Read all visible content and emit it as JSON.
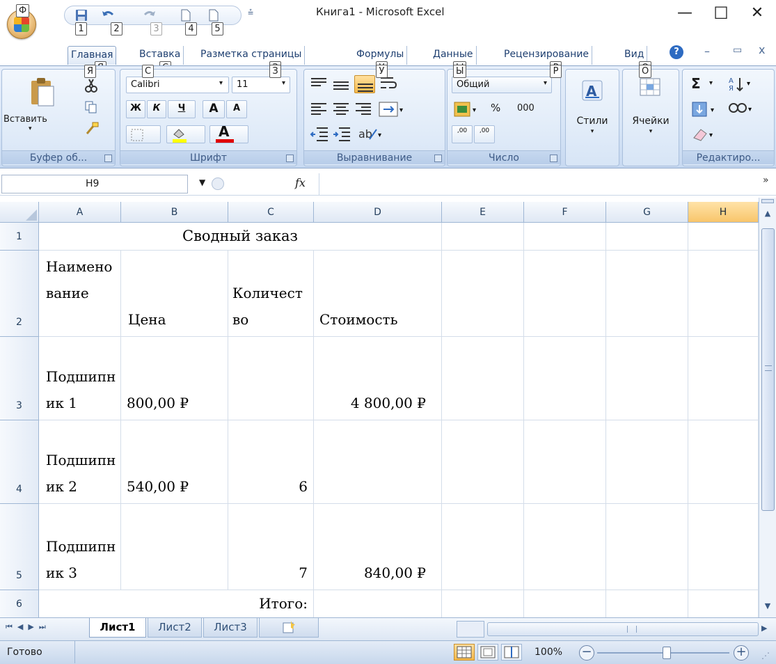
{
  "window": {
    "title": "Книга1 - Microsoft Excel",
    "min": "—",
    "max": "☐",
    "close": "✕",
    "help": "?",
    "min2": "–",
    "restore2": "▭",
    "close2": "x"
  },
  "qat": {
    "keytips": [
      "1",
      "2",
      "3",
      "4",
      "5"
    ],
    "menu_glyph": "⩮",
    "office_keytip": "Ф"
  },
  "tabs": [
    {
      "label": "Главная",
      "keytip": "Я",
      "active": true
    },
    {
      "label": "Вставка",
      "keytip": "С"
    },
    {
      "label": "Разметка страницы",
      "keytip": "З"
    },
    {
      "label": "Формулы",
      "keytip": "У"
    },
    {
      "label": "Данные",
      "keytip": "Ы"
    },
    {
      "label": "Рецензирование",
      "keytip": "Р"
    },
    {
      "label": "Вид",
      "keytip": "О"
    }
  ],
  "ribbon": {
    "clipboard": {
      "label": "Буфер об...",
      "paste": "Вставить"
    },
    "font": {
      "label": "Шрифт",
      "font_name": "Calibri",
      "font_size": "11",
      "bold": "Ж",
      "italic": "К",
      "underline": "Ч",
      "grow": "A",
      "shrink": "A",
      "font_color": "A",
      "fill_color": "#ffff00",
      "text_color": "#e00000"
    },
    "alignment": {
      "label": "Выравнивание"
    },
    "number": {
      "label": "Число",
      "format": "Общий",
      "percent": "%",
      "thousands": "000",
      "inc_dec": ",00",
      "dec_dec": ",00"
    },
    "styles": {
      "label": "Стили"
    },
    "cells": {
      "label": "Ячейки"
    },
    "editing": {
      "label": "Редактиро...",
      "sum": "Σ"
    }
  },
  "formula_bar": {
    "name_box": "H9",
    "fx": "fx",
    "value": ""
  },
  "sheet": {
    "columns": [
      "A",
      "B",
      "C",
      "D",
      "E",
      "F",
      "G",
      "H"
    ],
    "rows": [
      "1",
      "2",
      "3",
      "4",
      "5",
      "6"
    ],
    "cells": {
      "title": "Сводный заказ",
      "a2": "Наименование",
      "b2": "Цена",
      "c2": "Количество",
      "d2": "Стоимость",
      "a3": "Подшипник 1",
      "b3": "800,00 ₽",
      "d3": "4 800,00 ₽",
      "a4": "Подшипник 2",
      "b4": "540,00 ₽",
      "c4": "6",
      "a5": "Подшипник 3",
      "c5": "7",
      "d5": "840,00 ₽",
      "c6": "Итого:"
    }
  },
  "sheet_tabs": [
    "Лист1",
    "Лист2",
    "Лист3"
  ],
  "status": {
    "ready": "Готово",
    "zoom": "100%"
  }
}
